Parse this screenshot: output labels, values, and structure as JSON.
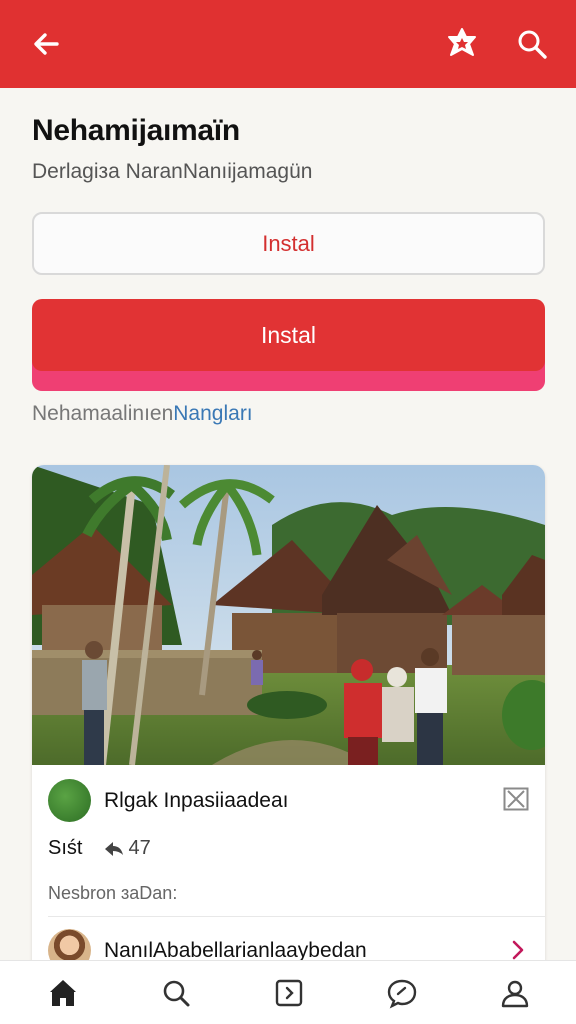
{
  "appbar": {
    "back_icon": "arrow-left-icon",
    "star_icon": "star-badge-icon",
    "search_icon": "search-icon",
    "background": "#e03131"
  },
  "header": {
    "title": "Nehamijaımaïn",
    "subtitle": "Derlagiза NaranNanıijamagün"
  },
  "buttons": {
    "outline_label": "Instal",
    "primary_label": "Instal",
    "primary_color": "#e13334",
    "accent_strip_color": "#ef3f73"
  },
  "link": {
    "text_plain": "Nehamaalinıen",
    "text_accent": "Nangları"
  },
  "card": {
    "photo_alt": "Traditional village houses with people standing in front",
    "row1": {
      "label": "Rlgak Inpasiiaadeaı",
      "close_icon": "close-box-icon"
    },
    "stats": {
      "label": "Sıśt",
      "arrow_icon": "reply-arrow-icon",
      "count": "47"
    },
    "meta": "Nesbron ɜaDan:",
    "row2": {
      "label": "NanılAbabellarianlaaybedan",
      "chevron_icon": "chevron-right-icon"
    }
  },
  "bottom_nav": [
    {
      "name": "nav-home",
      "icon": "home-icon"
    },
    {
      "name": "nav-search",
      "icon": "search-icon"
    },
    {
      "name": "nav-play",
      "icon": "play-square-icon"
    },
    {
      "name": "nav-chat",
      "icon": "chat-icon"
    },
    {
      "name": "nav-profile",
      "icon": "profile-icon"
    }
  ]
}
